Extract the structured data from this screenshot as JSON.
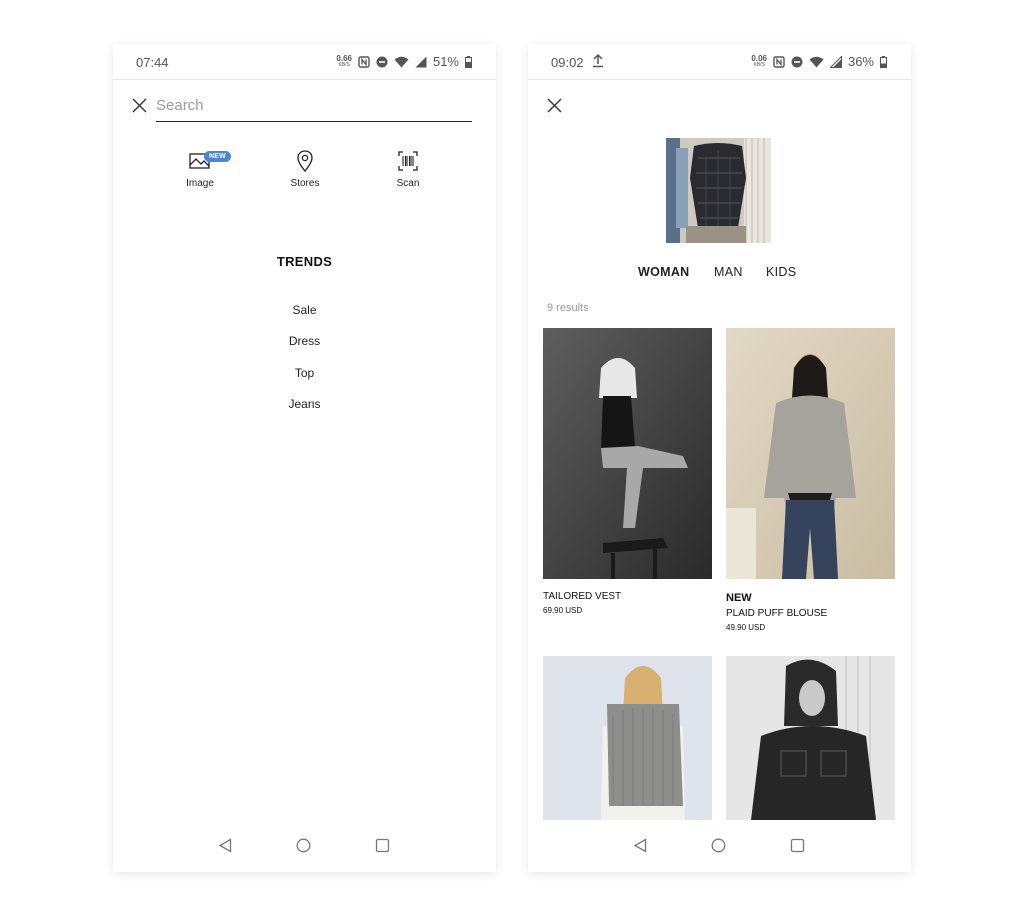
{
  "left": {
    "status": {
      "time": "07:44",
      "speed_value": "0.66",
      "speed_unit": "KB/S",
      "battery": "51%"
    },
    "search": {
      "placeholder": "Search"
    },
    "quick_actions": [
      {
        "label": "Image",
        "badge": "NEW",
        "icon": "image-search-icon"
      },
      {
        "label": "Stores",
        "icon": "location-pin-icon"
      },
      {
        "label": "Scan",
        "icon": "barcode-scan-icon"
      }
    ],
    "trends": {
      "title": "TRENDS",
      "items": [
        "Sale",
        "Dress",
        "Top",
        "Jeans"
      ]
    }
  },
  "right": {
    "status": {
      "time": "09:02",
      "speed_value": "0.06",
      "speed_unit": "KB/S",
      "battery": "36%"
    },
    "categories": [
      {
        "label": "WOMAN",
        "active": true
      },
      {
        "label": "MAN",
        "active": false
      },
      {
        "label": "KIDS",
        "active": false
      }
    ],
    "results_count": "9 results",
    "products": [
      {
        "badge": "",
        "name": "TAILORED VEST",
        "price": "69.90 USD"
      },
      {
        "badge": "NEW",
        "name": "PLAID PUFF BLOUSE",
        "price": "49.90 USD"
      },
      {
        "badge": "",
        "name": "",
        "price": ""
      },
      {
        "badge": "",
        "name": "",
        "price": ""
      }
    ]
  },
  "colors": {
    "accent_badge": "#4a86d4",
    "text": "#111111",
    "muted": "#9a9a9a"
  }
}
